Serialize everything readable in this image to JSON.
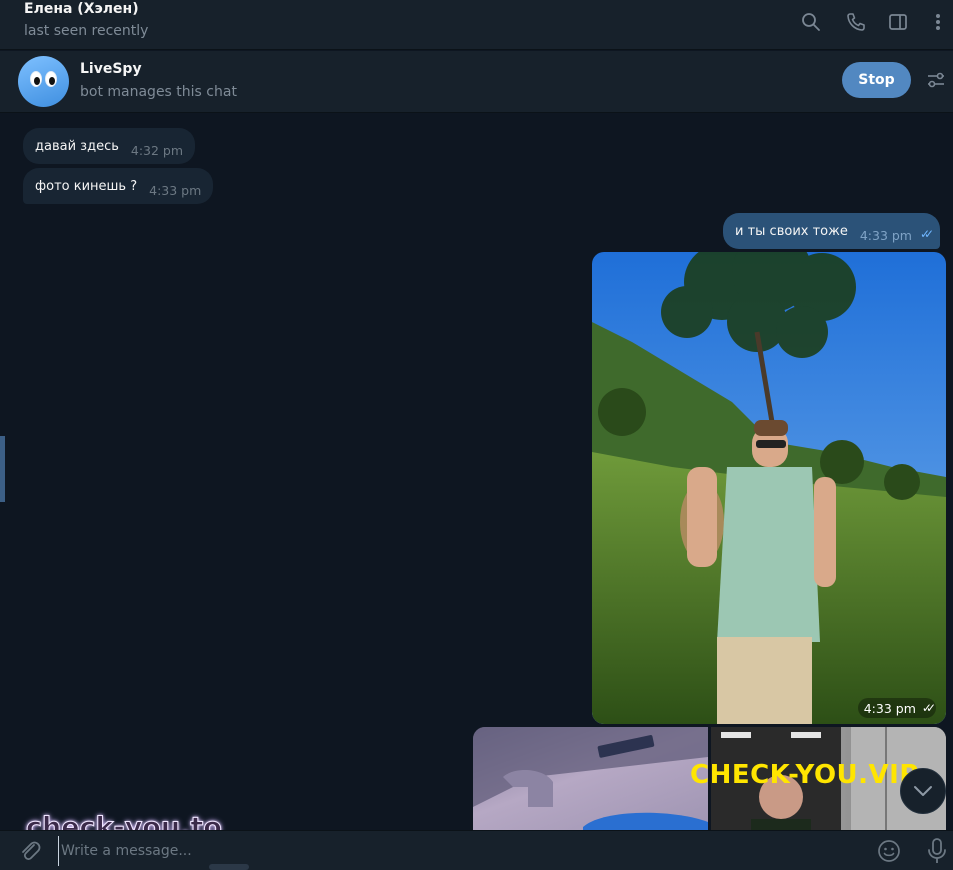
{
  "header": {
    "name": "Елена (Хэлен)",
    "status": "last seen recently",
    "icons": [
      "search-icon",
      "phone-icon",
      "sidebar-toggle-icon",
      "more-icon"
    ]
  },
  "bot": {
    "name": "LiveSpy",
    "subtitle": "bot manages this chat",
    "stop_label": "Stop",
    "settings_icon": "filter-settings-icon"
  },
  "messages": [
    {
      "direction": "in",
      "text": "давай здесь",
      "time": "4:32 pm"
    },
    {
      "direction": "in",
      "text": "фото кинешь ?",
      "time": "4:33 pm"
    },
    {
      "direction": "out",
      "text": "и ты своих тоже",
      "time": "4:33 pm",
      "read": true
    },
    {
      "direction": "out",
      "type": "photo",
      "time": "4:33 pm",
      "read": true
    }
  ],
  "watermarks": {
    "vip": "CHECK-YOU.VIP",
    "to": "check-you.to"
  },
  "composer": {
    "placeholder": "Write a message...",
    "icons": [
      "attach-icon",
      "emoji-icon",
      "microphone-icon"
    ]
  },
  "colors": {
    "background": "#0e1621",
    "panel": "#17212b",
    "incoming_bubble": "#182533",
    "outgoing_bubble": "#2b5278",
    "accent": "#5288c1"
  }
}
